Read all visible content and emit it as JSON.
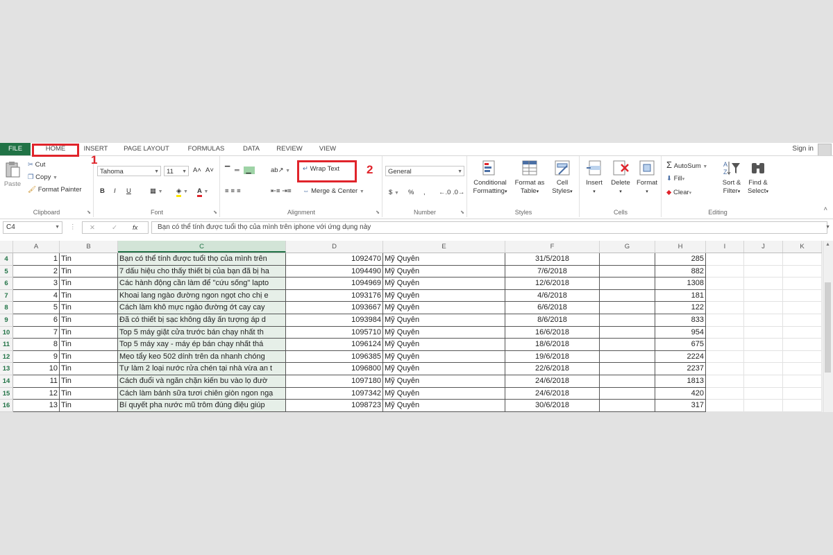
{
  "tabs": {
    "file": "FILE",
    "home": "HOME",
    "insert": "INSERT",
    "page_layout": "PAGE LAYOUT",
    "formulas": "FORMULAS",
    "data": "DATA",
    "review": "REVIEW",
    "view": "VIEW",
    "sign_in": "Sign in"
  },
  "clipboard": {
    "paste": "Paste",
    "cut": "Cut",
    "copy": "Copy",
    "format_painter": "Format Painter",
    "label": "Clipboard"
  },
  "font": {
    "name": "Tahoma",
    "size": "11",
    "bold": "B",
    "italic": "I",
    "underline": "U",
    "grow": "A˄",
    "shrink": "A˅",
    "label": "Font"
  },
  "alignment": {
    "wrap_text": "Wrap Text",
    "merge_center": "Merge & Center",
    "label": "Alignment"
  },
  "number": {
    "format": "General",
    "currency": "$",
    "percent": "%",
    "comma": ",",
    "label": "Number"
  },
  "styles": {
    "conditional_1": "Conditional",
    "conditional_2": "Formatting",
    "format_table_1": "Format as",
    "format_table_2": "Table",
    "cell_styles_1": "Cell",
    "cell_styles_2": "Styles",
    "label": "Styles"
  },
  "cells": {
    "insert": "Insert",
    "delete": "Delete",
    "format": "Format",
    "label": "Cells"
  },
  "editing": {
    "autosum": "AutoSum",
    "fill": "Fill",
    "clear": "Clear",
    "sort_1": "Sort &",
    "sort_2": "Filter",
    "find_1": "Find &",
    "find_2": "Select",
    "label": "Editing"
  },
  "annotations": {
    "step1": "1",
    "step2": "2",
    "color": "#e0242b"
  },
  "formula_bar": {
    "name_box": "C4",
    "cancel": "✕",
    "enter": "✓",
    "fx": "fx",
    "value": "Bạn có thể tính được tuổi thọ của mình trên iphone với ứng dụng này"
  },
  "columns": [
    "A",
    "B",
    "C",
    "D",
    "E",
    "F",
    "G",
    "H",
    "I",
    "J",
    "K"
  ],
  "rows": [
    {
      "row": "4",
      "a": "1",
      "b": "Tin",
      "c": "Bạn có thể tính được tuổi thọ của mình trên",
      "d": "1092470",
      "e": "Mỹ Quyên",
      "f": "31/5/2018",
      "h": "285"
    },
    {
      "row": "5",
      "a": "2",
      "b": "Tin",
      "c": "7 dấu hiệu cho thấy thiết bị của bạn đã bị ha",
      "d": "1094490",
      "e": "Mỹ Quyên",
      "f": "7/6/2018",
      "h": "882"
    },
    {
      "row": "6",
      "a": "3",
      "b": "Tin",
      "c": "Các hành động cần làm để \"cứu sống\" lapto",
      "d": "1094969",
      "e": "Mỹ Quyên",
      "f": "12/6/2018",
      "h": "1308"
    },
    {
      "row": "7",
      "a": "4",
      "b": "Tin",
      "c": "Khoai lang ngào đường ngon ngọt cho chị e",
      "d": "1093176",
      "e": "Mỹ Quyên",
      "f": "4/6/2018",
      "h": "181"
    },
    {
      "row": "8",
      "a": "5",
      "b": "Tin",
      "c": "Cách làm khô mực ngào đường ớt cay cay",
      "d": "1093667",
      "e": "Mỹ Quyên",
      "f": "6/6/2018",
      "h": "122"
    },
    {
      "row": "9",
      "a": "6",
      "b": "Tin",
      "c": "Đã có thiết bị sạc không dây ấn tượng áp d",
      "d": "1093984",
      "e": "Mỹ Quyên",
      "f": "8/6/2018",
      "h": "833"
    },
    {
      "row": "10",
      "a": "7",
      "b": "Tin",
      "c": "Top 5 máy giặt cửa trước bán chạy nhất th",
      "d": "1095710",
      "e": "Mỹ Quyên",
      "f": "16/6/2018",
      "h": "954"
    },
    {
      "row": "11",
      "a": "8",
      "b": "Tin",
      "c": "Top 5 máy xay - máy ép bán chạy nhất thá",
      "d": "1096124",
      "e": "Mỹ Quyên",
      "f": "18/6/2018",
      "h": "675"
    },
    {
      "row": "12",
      "a": "9",
      "b": "Tin",
      "c": "Mẹo tẩy keo 502 dính trên da nhanh chóng",
      "d": "1096385",
      "e": "Mỹ Quyên",
      "f": "19/6/2018",
      "h": "2224"
    },
    {
      "row": "13",
      "a": "10",
      "b": "Tin",
      "c": "Tự làm 2 loại nước rửa chén tại nhà vừa an t",
      "d": "1096800",
      "e": "Mỹ Quyên",
      "f": "22/6/2018",
      "h": "2237"
    },
    {
      "row": "14",
      "a": "11",
      "b": "Tin",
      "c": "Cách đuổi và ngăn chặn kiến bu vào lọ đườ",
      "d": "1097180",
      "e": "Mỹ Quyên",
      "f": "24/6/2018",
      "h": "1813"
    },
    {
      "row": "15",
      "a": "12",
      "b": "Tin",
      "c": "Cách làm bánh sữa tươi chiên giòn ngon ngạ",
      "d": "1097342",
      "e": "Mỹ Quyên",
      "f": "24/6/2018",
      "h": "420"
    },
    {
      "row": "16",
      "a": "13",
      "b": "Tin",
      "c": "Bí quyết pha nước mũ trôm đúng điệu giúp",
      "d": "1098723",
      "e": "Mỹ Quyên",
      "f": "30/6/2018",
      "h": "317"
    }
  ]
}
